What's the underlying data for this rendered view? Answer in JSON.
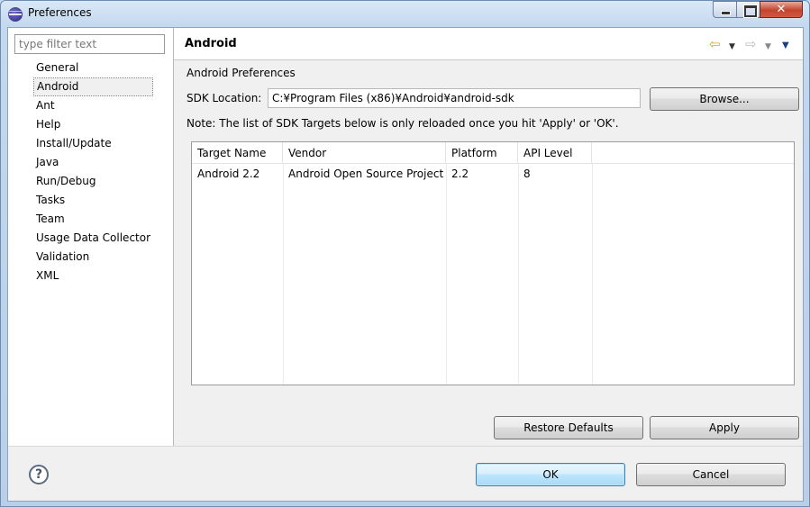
{
  "window": {
    "title": "Preferences"
  },
  "filter": {
    "placeholder": "type filter text"
  },
  "tree": [
    "General",
    "Android",
    "Ant",
    "Help",
    "Install/Update",
    "Java",
    "Run/Debug",
    "Tasks",
    "Team",
    "Usage Data Collector",
    "Validation",
    "XML"
  ],
  "tree_selected": "Android",
  "page": {
    "title": "Android",
    "section_label": "Android Preferences",
    "sdk_label": "SDK Location:",
    "sdk_value": "C:¥Program Files (x86)¥Android¥android-sdk",
    "browse_label": "Browse...",
    "note": "Note: The list of SDK Targets below is only reloaded once you hit 'Apply' or 'OK'."
  },
  "table": {
    "headers": [
      "Target Name",
      "Vendor",
      "Platform",
      "API Level"
    ],
    "rows": [
      [
        "Android 2.2",
        "Android Open Source Project",
        "2.2",
        "8"
      ]
    ]
  },
  "buttons": {
    "restore_defaults": "Restore Defaults",
    "apply": "Apply",
    "ok": "OK",
    "cancel": "Cancel",
    "help": "?"
  },
  "icons": {
    "app": "eclipse-icon",
    "back": "back-arrow-icon",
    "forward": "forward-arrow-icon",
    "menu": "view-menu-icon",
    "help": "help-icon"
  }
}
